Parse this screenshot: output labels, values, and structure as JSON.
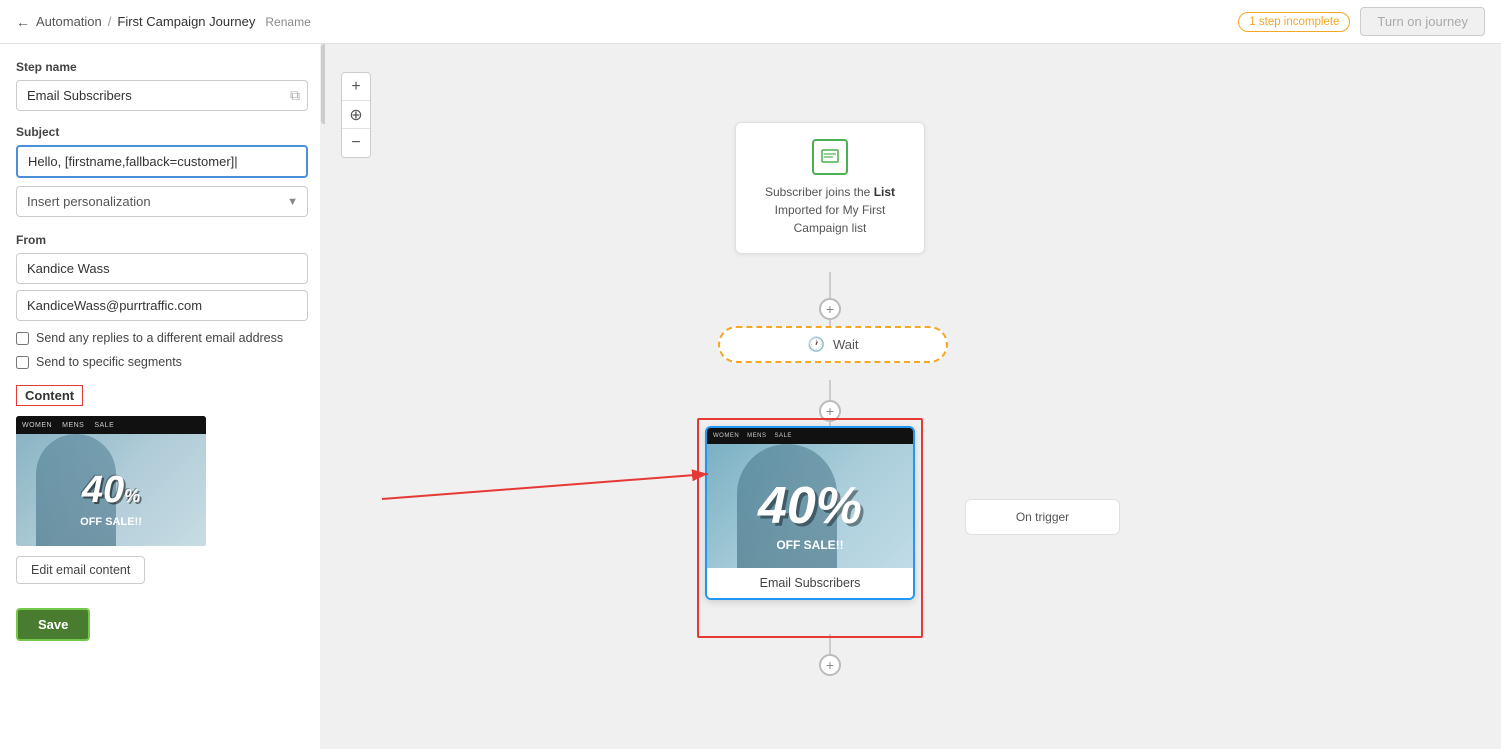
{
  "header": {
    "back_label": "←",
    "breadcrumb_sep": "/",
    "automation_label": "Automation",
    "journey_name": "First Campaign Journey",
    "rename_label": "Rename",
    "incomplete_badge": "1 step incomplete",
    "turn_on_label": "Turn on journey"
  },
  "left_panel": {
    "step_name_label": "Step name",
    "step_name_value": "Email Subscribers",
    "subject_label": "Subject",
    "subject_value": "Hello, [firstname,fallback=customer]|",
    "personalization_label": "Insert personalization",
    "from_label": "From",
    "from_name": "Kandice Wass",
    "from_email": "KandiceWass@purrtraffic.com",
    "checkbox1_label": "Send any replies to a different email address",
    "checkbox2_label": "Send to specific segments",
    "content_label": "Content",
    "edit_email_label": "Edit email content",
    "save_label": "Save"
  },
  "canvas": {
    "zoom_plus": "+",
    "zoom_move": "⊕",
    "zoom_minus": "−",
    "subscriber_node": {
      "text_line1": "Subscriber joins the",
      "text_line2": "List",
      "text_line3": "Imported for My First",
      "text_line4": "Campaign list"
    },
    "wait_label": "Wait",
    "email_node_label": "Email Subscribers",
    "trigger_label": "On trigger"
  },
  "thumbnail": {
    "nav_items": [
      "WOMEN",
      "MENS",
      "SALE"
    ],
    "promo_text": "40%",
    "off_text": "OFF SALE!!"
  }
}
